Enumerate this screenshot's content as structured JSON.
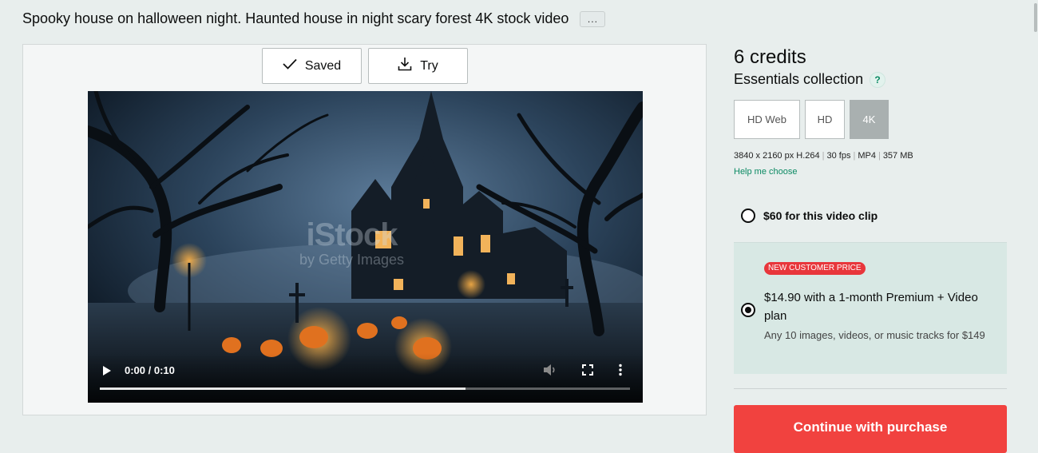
{
  "header": {
    "title": "Spooky house on halloween night. Haunted house in night scary forest 4K stock video",
    "more_label": "..."
  },
  "actions": {
    "saved_label": "Saved",
    "try_label": "Try"
  },
  "video": {
    "watermark_brand": "iStock",
    "watermark_sub": "by Getty Images",
    "time_display": "0:00 / 0:10",
    "progress_fraction": 0.69
  },
  "pricing": {
    "credits": "6 credits",
    "collection": "Essentials collection",
    "help_badge": "?",
    "resolutions": [
      {
        "label": "HD Web",
        "selected": false
      },
      {
        "label": "HD",
        "selected": false
      },
      {
        "label": "4K",
        "selected": true
      }
    ],
    "specs": {
      "dimensions": "3840 x 2160 px H.264",
      "fps": "30 fps",
      "format": "MP4",
      "size": "357 MB"
    },
    "help_link": "Help me choose",
    "option_single": {
      "label": "$60 for this video clip",
      "selected": false
    },
    "option_plan": {
      "badge": "NEW CUSTOMER PRICE",
      "title": "$14.90 with a 1-month Premium + Video plan",
      "subtitle": "Any 10 images, videos, or music tracks for $149",
      "selected": true
    },
    "continue_label": "Continue with purchase"
  },
  "colors": {
    "accent_green": "#0b8a63",
    "purchase_red": "#f1423f",
    "badge_red": "#e8363b",
    "promo_bg": "#d8e8e4"
  },
  "icons": {
    "saved": "check-icon",
    "try": "download-icon",
    "play": "play-icon",
    "volume": "volume-icon",
    "fullscreen": "fullscreen-icon",
    "menu": "more-vertical-icon"
  }
}
